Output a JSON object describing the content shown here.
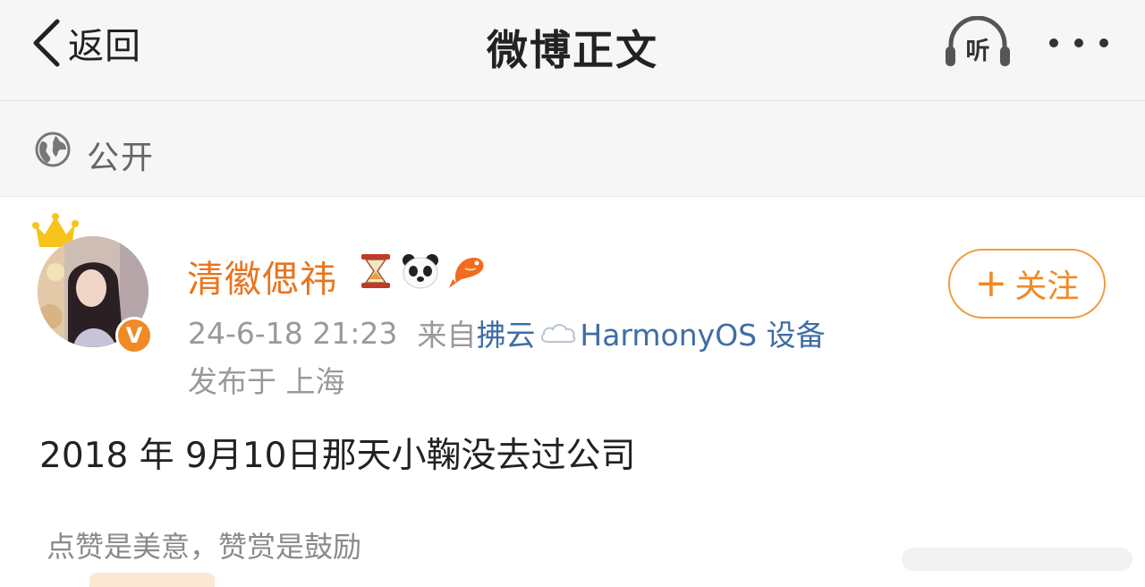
{
  "header": {
    "back_label": "返回",
    "title": "微博正文",
    "listen_label": "听",
    "icons": {
      "back": "chevron-left-icon",
      "listen": "headphones-icon",
      "more": "more-dots-icon"
    }
  },
  "visibility": {
    "label": "公开",
    "icon": "globe-icon"
  },
  "post": {
    "author": {
      "name": "清徽偲祎",
      "badges": [
        "hourglass-emoji",
        "panda-emoji",
        "koi-fish-emoji"
      ],
      "verified": "V",
      "avatar_crown": "crown-icon"
    },
    "follow_label": "关注",
    "timestamp": "24-6-18 21:23",
    "source_prefix": "来自",
    "source_name": "拂云",
    "source_suffix": "HarmonyOS 设备",
    "location": "发布于 上海",
    "text": "2018 年 9月10日那天小鞠没去过公司"
  },
  "reward": {
    "text": "点赞是美意，赞赏是鼓励"
  },
  "colors": {
    "accent_orange": "#e8741e",
    "link_blue": "#3f6da6",
    "header_bg": "#f6f6f6",
    "muted_text": "#999999"
  }
}
